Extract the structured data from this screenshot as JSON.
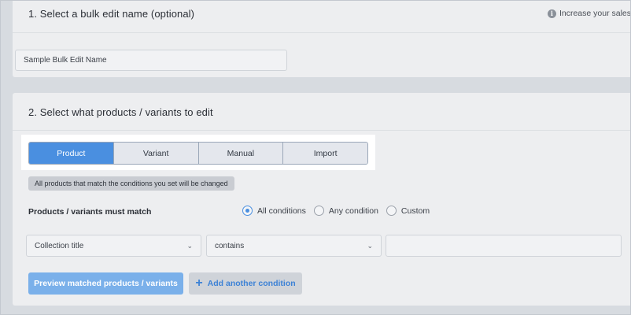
{
  "section1": {
    "title": "1. Select a bulk edit name (optional)",
    "hint": "Increase your sales",
    "name_value": "Sample Bulk Edit Name"
  },
  "section2": {
    "title": "2. Select what products / variants to edit",
    "tabs": [
      {
        "label": "Product",
        "active": true
      },
      {
        "label": "Variant",
        "active": false
      },
      {
        "label": "Manual",
        "active": false
      },
      {
        "label": "Import",
        "active": false
      }
    ],
    "notice": "All products that match the conditions you set will be changed",
    "match_label": "Products / variants must match",
    "match_options": [
      {
        "label": "All conditions",
        "checked": true
      },
      {
        "label": "Any condition",
        "checked": false
      },
      {
        "label": "Custom",
        "checked": false
      }
    ],
    "condition": {
      "field": "Collection title",
      "operator": "contains",
      "value": ""
    },
    "preview_button": "Preview matched products / variants",
    "add_condition_button": "Add another condition"
  },
  "colors": {
    "accent": "#4a8fe0",
    "preview_button": "#7ab0ea",
    "background": "#d7dbe0",
    "card": "#edeef0"
  },
  "icons": {
    "info": "info-icon",
    "chevron": "chevron-down-icon",
    "plus": "plus-icon"
  }
}
